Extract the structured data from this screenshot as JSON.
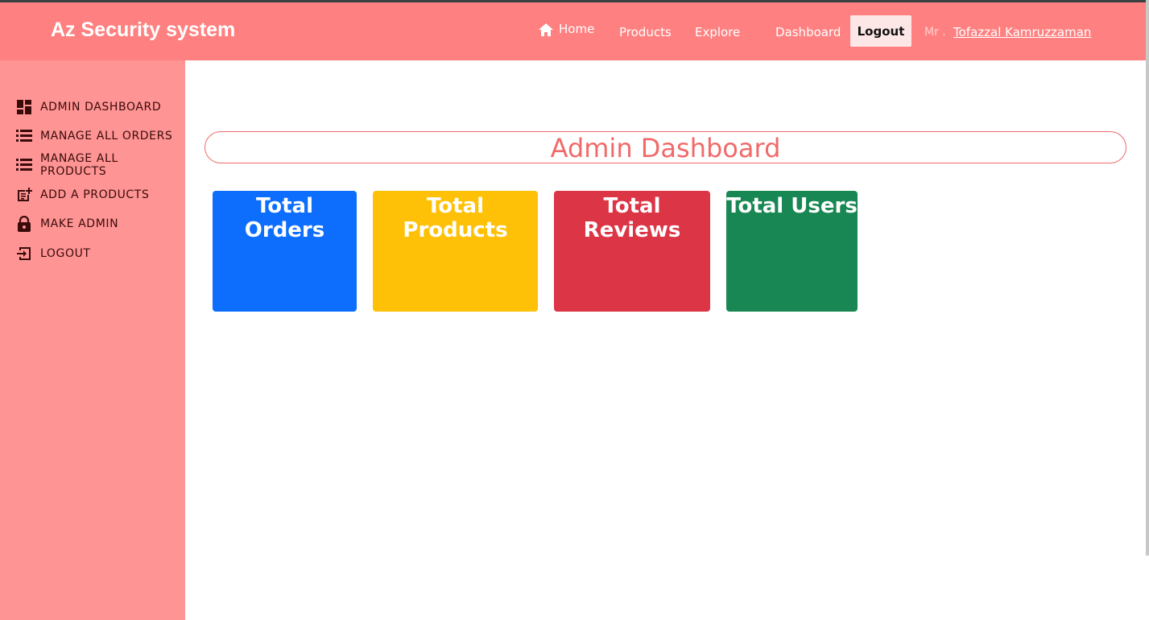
{
  "app": {
    "brand": "Az Security system"
  },
  "nav": {
    "home": "Home",
    "products": "Products",
    "explore": "Explore",
    "dashboard": "Dashboard",
    "logout": "Logout",
    "mr": "Mr .",
    "user": "Tofazzal Kamruzzaman"
  },
  "sidebar": {
    "items": [
      {
        "label": "ADMIN DASHBOARD",
        "icon": "dashboard-icon"
      },
      {
        "label": "MANAGE ALL ORDERS",
        "icon": "list-icon"
      },
      {
        "label": "MANAGE ALL PRODUCTS",
        "icon": "list-icon"
      },
      {
        "label": "ADD A PRODUCTS",
        "icon": "post-add-icon"
      },
      {
        "label": "MAKE ADMIN",
        "icon": "lock-icon"
      },
      {
        "label": "LOGOUT",
        "icon": "logout-icon"
      }
    ]
  },
  "main": {
    "title": "Admin Dashboard",
    "cards": [
      {
        "label": "Total Orders",
        "color": "#0d6efd"
      },
      {
        "label": "Total Products",
        "color": "#ffc107"
      },
      {
        "label": "Total Reviews",
        "color": "#dc3545"
      },
      {
        "label": "Total Users",
        "color": "#198754"
      }
    ]
  },
  "colors": {
    "navbar": "#ff8080",
    "sidebar": "#ff9494",
    "accent": "#f06a6a"
  }
}
